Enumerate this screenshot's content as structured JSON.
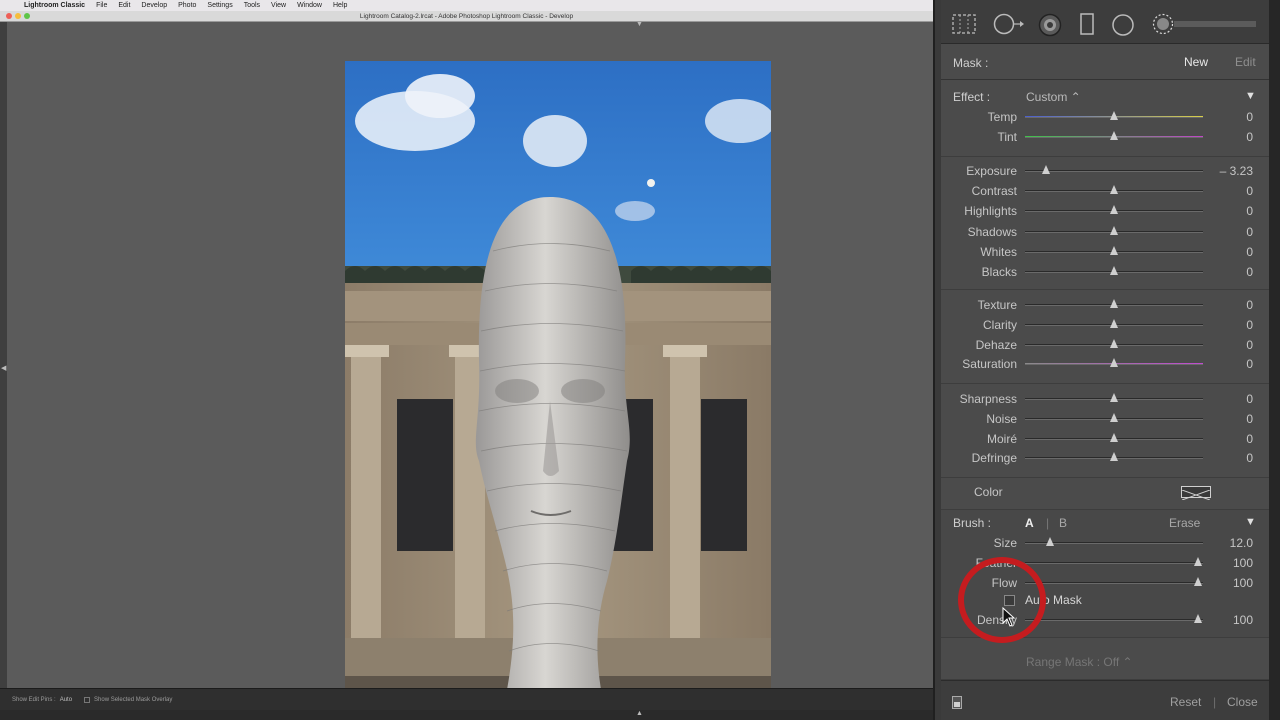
{
  "menubar": {
    "app_name": "Lightroom Classic",
    "items": [
      "File",
      "Edit",
      "Develop",
      "Photo",
      "Settings",
      "Tools",
      "View",
      "Window",
      "Help"
    ]
  },
  "window": {
    "title": "Lightroom Catalog-2.lrcat - Adobe Photoshop Lightroom Classic - Develop"
  },
  "toolbar": {
    "show_edit_pins_label": "Show Edit Pins :",
    "show_edit_pins_value": "Auto",
    "show_mask_overlay_label": "Show Selected Mask Overlay"
  },
  "panel": {
    "mask_label": "Mask :",
    "mask_new": "New",
    "mask_edit": "Edit",
    "effect_label": "Effect :",
    "effect_preset": "Custom",
    "sliders_effect": [
      {
        "name": "Temp",
        "value": "0",
        "pos": 0.5
      },
      {
        "name": "Tint",
        "value": "0",
        "pos": 0.5
      }
    ],
    "sliders_tone": [
      {
        "name": "Exposure",
        "value": "– 3.23",
        "pos": 0.12
      },
      {
        "name": "Contrast",
        "value": "0",
        "pos": 0.5
      },
      {
        "name": "Highlights",
        "value": "0",
        "pos": 0.5
      },
      {
        "name": "Shadows",
        "value": "0",
        "pos": 0.5
      },
      {
        "name": "Whites",
        "value": "0",
        "pos": 0.5
      },
      {
        "name": "Blacks",
        "value": "0",
        "pos": 0.5
      }
    ],
    "sliders_presence": [
      {
        "name": "Texture",
        "value": "0",
        "pos": 0.5
      },
      {
        "name": "Clarity",
        "value": "0",
        "pos": 0.5
      },
      {
        "name": "Dehaze",
        "value": "0",
        "pos": 0.5
      },
      {
        "name": "Saturation",
        "value": "0",
        "pos": 0.5
      }
    ],
    "sliders_detail": [
      {
        "name": "Sharpness",
        "value": "0",
        "pos": 0.5
      },
      {
        "name": "Noise",
        "value": "0",
        "pos": 0.5
      },
      {
        "name": "Moiré",
        "value": "0",
        "pos": 0.5
      },
      {
        "name": "Defringe",
        "value": "0",
        "pos": 0.5
      }
    ],
    "color_label": "Color",
    "brush_label": "Brush :",
    "brush_a": "A",
    "brush_b": "B",
    "brush_erase": "Erase",
    "sliders_brush": [
      {
        "name": "Size",
        "value": "12.0",
        "pos": 0.14
      },
      {
        "name": "Feather",
        "value": "100",
        "pos": 0.97
      },
      {
        "name": "Flow",
        "value": "100",
        "pos": 0.97
      }
    ],
    "auto_mask_label": "Auto Mask",
    "density": {
      "name": "Density",
      "value": "100",
      "pos": 0.97
    },
    "range_mask_label": "Range Mask : Off",
    "reset_label": "Reset",
    "close_label": "Close"
  },
  "colors": {
    "temp_gradient": [
      "#4b5fd0",
      "#d8cf48"
    ],
    "tint_gradient": [
      "#3fc24a",
      "#c046c8"
    ],
    "saturation_gradient": [
      "#8a8a8a",
      "#c04bd0"
    ],
    "highlight_ring": "#c51c1f"
  }
}
